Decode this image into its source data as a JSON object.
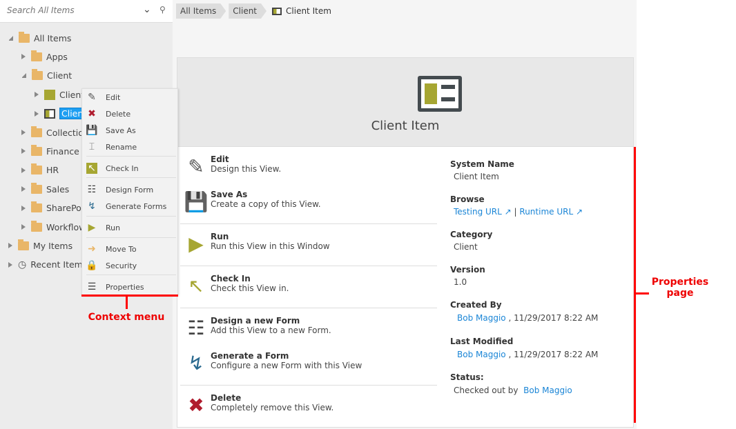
{
  "search": {
    "placeholder": "Search All Items"
  },
  "tree": [
    {
      "label": "All Items",
      "level": 0
    },
    {
      "label": "Apps",
      "level": 1
    },
    {
      "label": "Client",
      "level": 1
    },
    {
      "label": "Client",
      "level": 2
    },
    {
      "label": "Client",
      "level": 2,
      "selected": true
    },
    {
      "label": "Collection",
      "level": 1
    },
    {
      "label": "Finance",
      "level": 1
    },
    {
      "label": "HR",
      "level": 1
    },
    {
      "label": "Sales",
      "level": 1
    },
    {
      "label": "SharePoint",
      "level": 1
    },
    {
      "label": "Workflow",
      "level": 1
    },
    {
      "label": "My Items",
      "level": 0
    },
    {
      "label": "Recent Items",
      "level": 0
    }
  ],
  "context_menu": [
    "Edit",
    "Delete",
    "Save As",
    "Rename",
    "Check In",
    "Design Form",
    "Generate Forms",
    "Run",
    "Move To",
    "Security",
    "Properties"
  ],
  "breadcrumb": [
    "All Items",
    "Client",
    "Client Item"
  ],
  "panel": {
    "title": "Client Item"
  },
  "actions": [
    {
      "title": "Edit",
      "desc": "Design this View."
    },
    {
      "title": "Save As",
      "desc": "Create a copy of this View."
    },
    {
      "title": "Run",
      "desc": "Run this View in this Window"
    },
    {
      "title": "Check In",
      "desc": "Check this View in."
    },
    {
      "title": "Design a new Form",
      "desc": "Add this View to a new Form."
    },
    {
      "title": "Generate a Form",
      "desc": "Configure a new Form with this View"
    },
    {
      "title": "Delete",
      "desc": "Completely remove this View."
    }
  ],
  "props": {
    "system_name_label": "System Name",
    "system_name": "Client Item",
    "browse_label": "Browse",
    "testing_url": "Testing URL",
    "sep": "|",
    "runtime_url": "Runtime URL",
    "category_label": "Category",
    "category": "Client",
    "version_label": "Version",
    "version": "1.0",
    "created_label": "Created By",
    "created_by": "Bob Maggio",
    "created_date": ", 11/29/2017 8:22 AM",
    "modified_label": "Last Modified",
    "modified_by": "Bob Maggio",
    "modified_date": ", 11/29/2017 8:22 AM",
    "status_label": "Status:",
    "status": "Checked out by",
    "status_user": "Bob Maggio"
  },
  "annotations": {
    "context": "Context menu",
    "properties_1": "Properties",
    "properties_2": "page"
  }
}
